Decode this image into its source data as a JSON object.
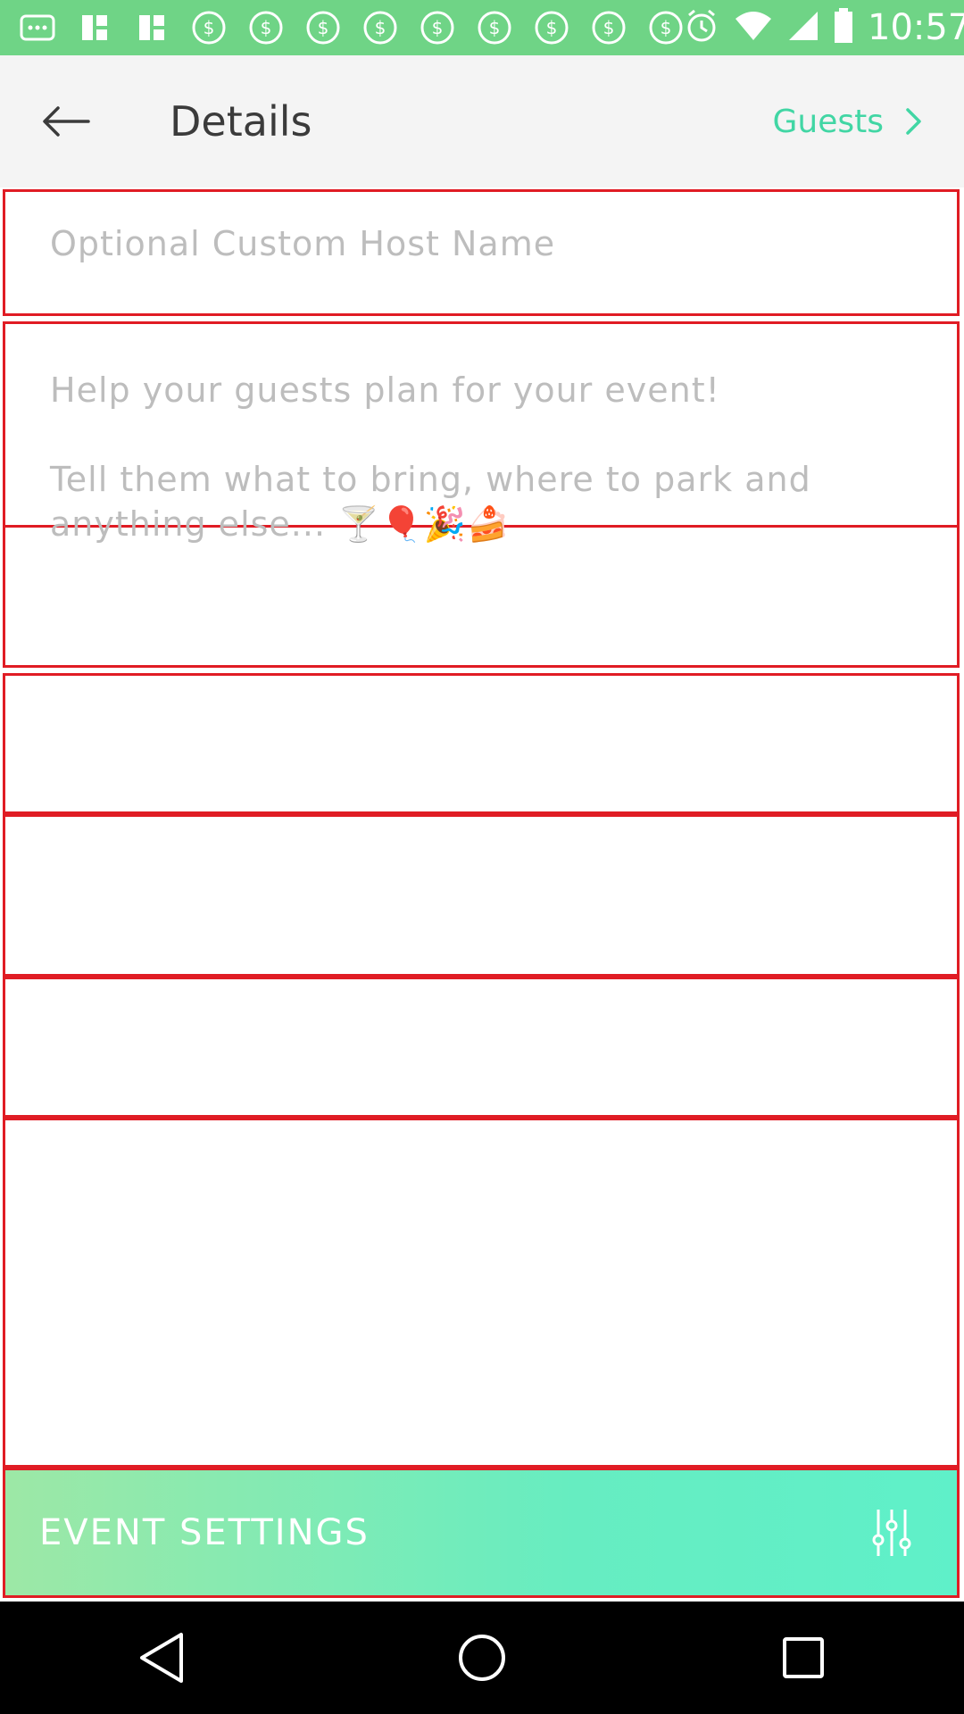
{
  "status_bar": {
    "time": "10:57",
    "notification_icons": [
      "more-icon",
      "grid-icon",
      "grid-icon",
      "dollar-icon",
      "dollar-icon",
      "dollar-icon",
      "dollar-icon",
      "dollar-icon",
      "dollar-icon",
      "dollar-icon",
      "dollar-icon",
      "dollar-icon"
    ]
  },
  "header": {
    "title": "Details",
    "guests_label": "Guests"
  },
  "host_name": {
    "placeholder": "Optional Custom Host Name",
    "value": ""
  },
  "description": {
    "line1": "Help your guests plan for your event!",
    "line2": "Tell them what to bring, where to park and",
    "line3": "anything else... 🍸🎈🎉🍰"
  },
  "event_settings": {
    "label": "EVENT SETTINGS"
  },
  "colors": {
    "accent": "#41d6a4",
    "status_bar": "#6fd486",
    "highlight_border": "#e01c24"
  }
}
